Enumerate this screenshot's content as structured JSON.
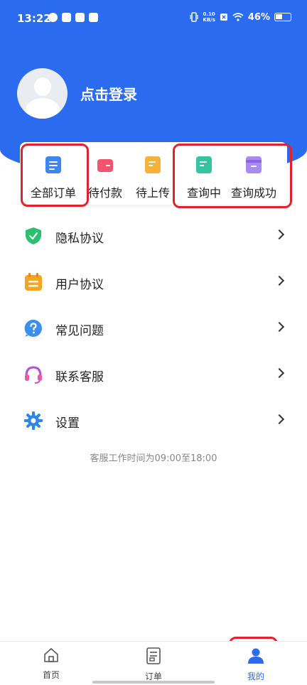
{
  "status_bar": {
    "time": "13:22",
    "net_speed_value": "0.10",
    "net_speed_unit": "KB/s",
    "battery": "46%"
  },
  "profile": {
    "login_prompt": "点击登录"
  },
  "orders": {
    "all": "全部订单",
    "pending_payment": "待付款",
    "pending_upload": "待上传",
    "querying": "查询中",
    "query_success": "查询成功"
  },
  "menu": [
    {
      "label": "隐私协议",
      "icon": "shield-check-icon",
      "color": "#2bbf6f"
    },
    {
      "label": "用户协议",
      "icon": "calendar-doc-icon",
      "color": "#f4a623"
    },
    {
      "label": "常见问题",
      "icon": "question-icon",
      "color": "#3b8ff0"
    },
    {
      "label": "联系客服",
      "icon": "headset-icon",
      "color": "#b84fd6"
    },
    {
      "label": "设置",
      "icon": "gear-icon",
      "color": "#2f86e6"
    }
  ],
  "service_hours": "客服工作时间为09:00至18:00",
  "bottom_nav": {
    "home": "首页",
    "orders": "订单",
    "mine": "我的"
  },
  "colors": {
    "brand": "#2a6bef",
    "highlight": "#e0232a"
  }
}
